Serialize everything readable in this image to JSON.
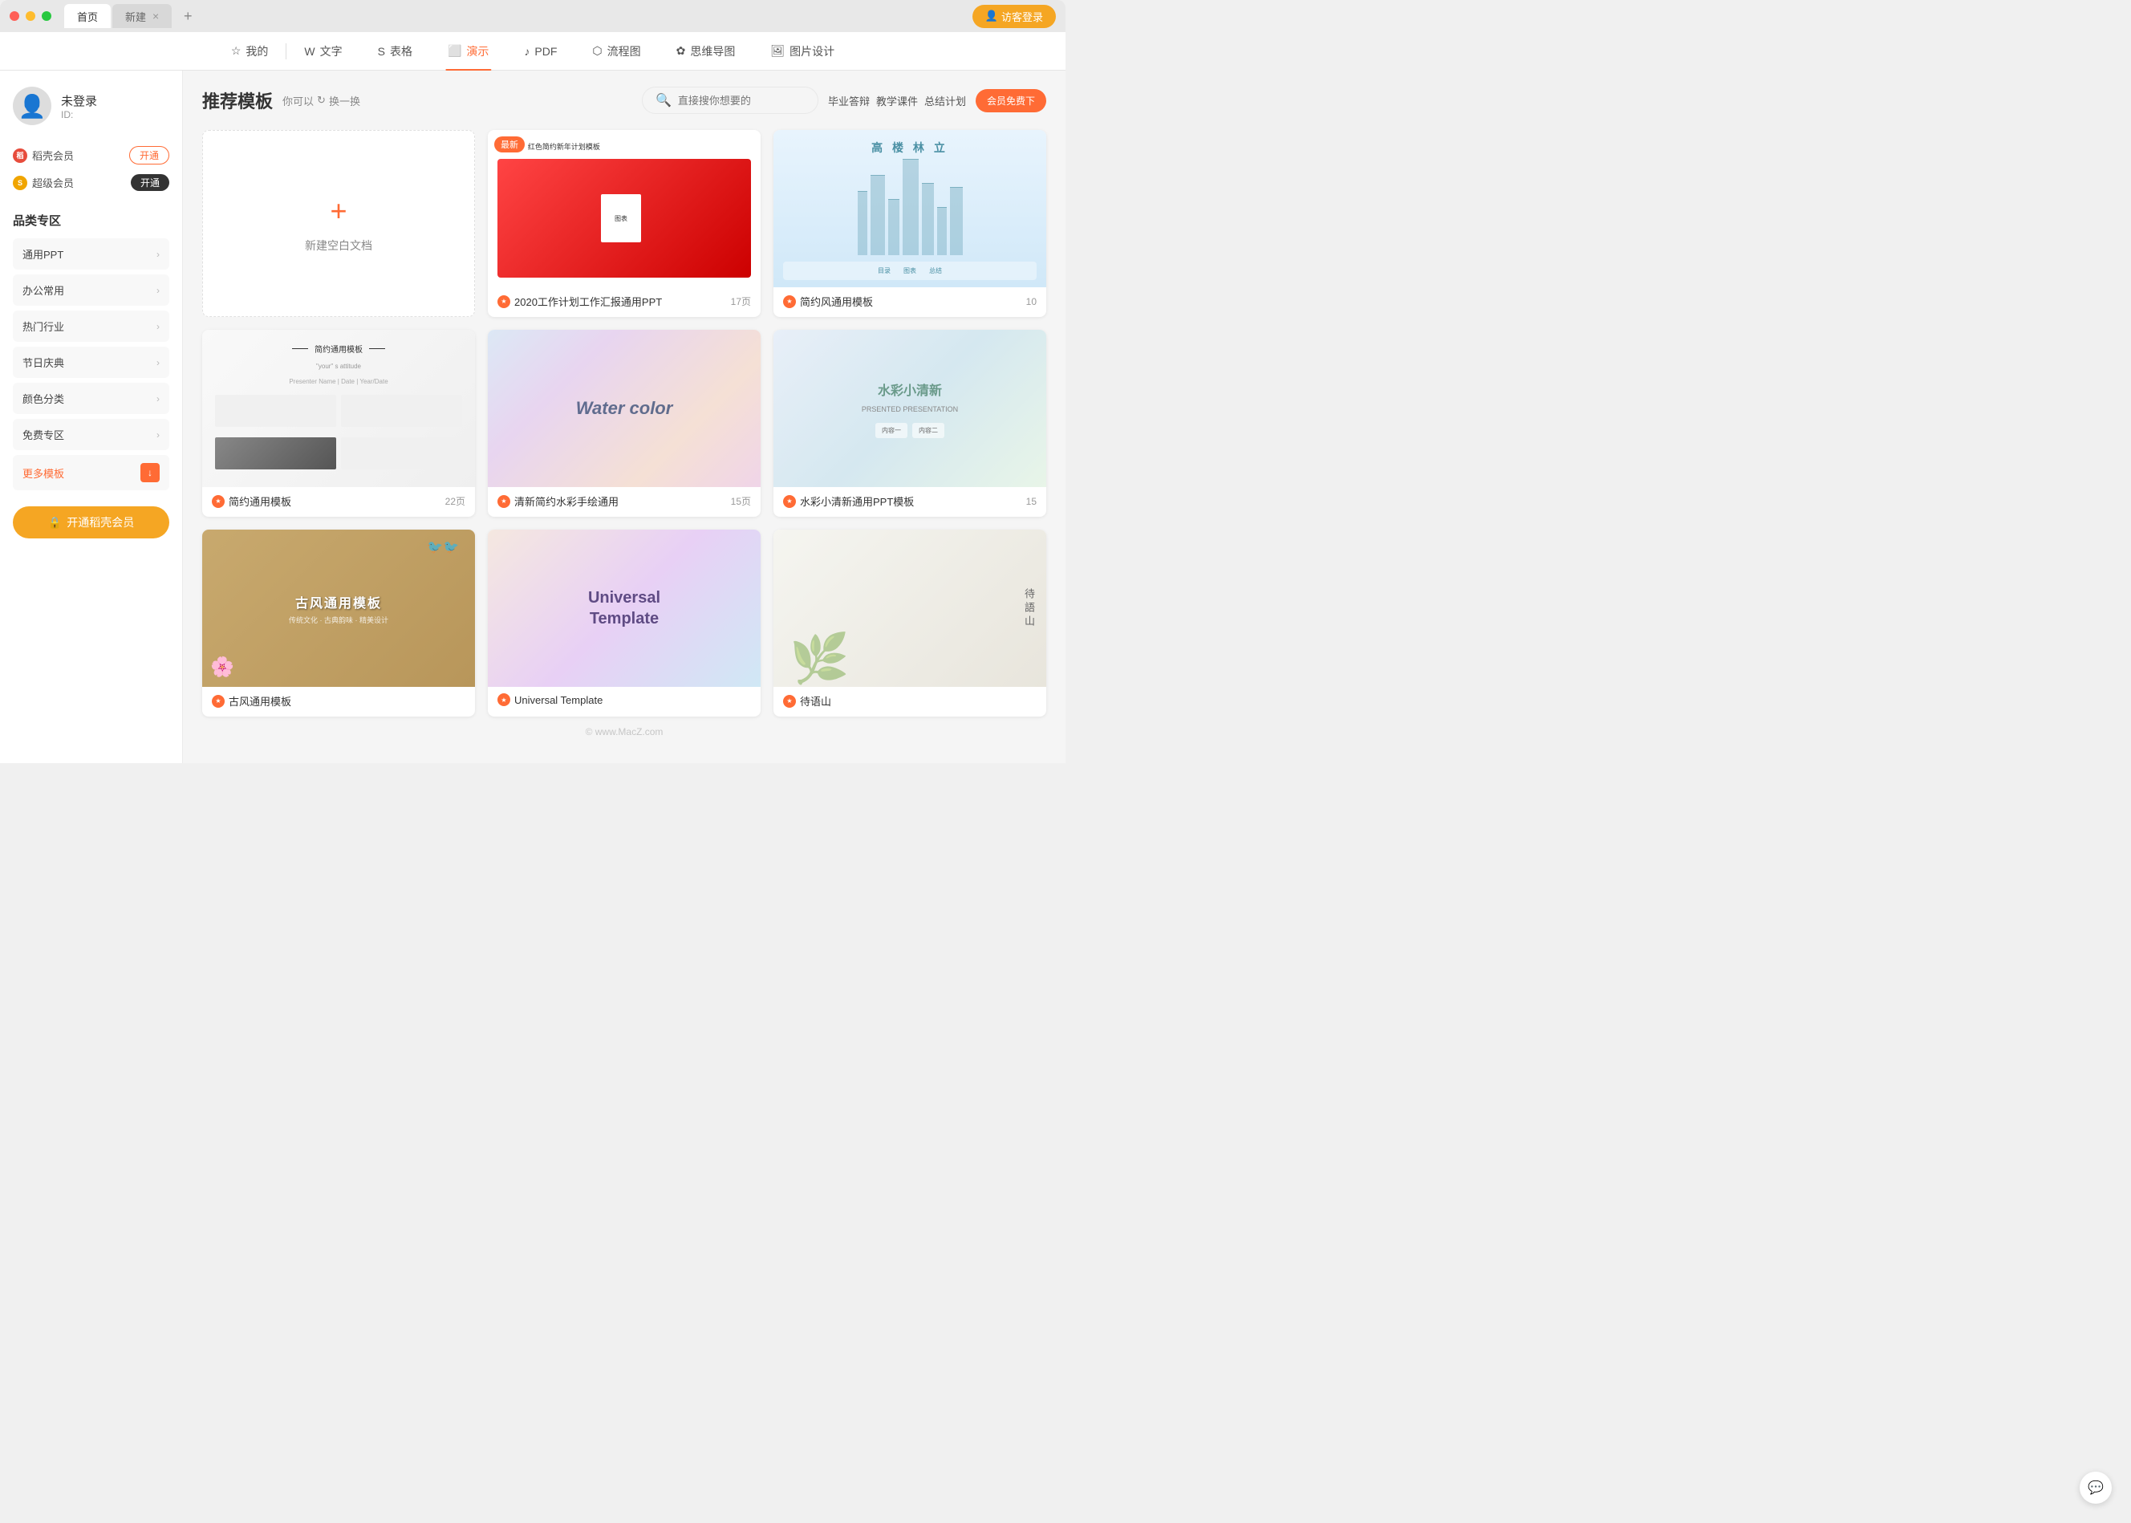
{
  "titlebar": {
    "tabs": [
      {
        "label": "首页",
        "active": true
      },
      {
        "label": "新建",
        "active": false
      }
    ],
    "tab_add_label": "+",
    "guest_login": "访客登录"
  },
  "navbar": {
    "items": [
      {
        "label": "我的",
        "icon": "star",
        "active": false
      },
      {
        "label": "文字",
        "icon": "W",
        "active": false
      },
      {
        "label": "表格",
        "icon": "S",
        "active": false
      },
      {
        "label": "演示",
        "icon": "P",
        "active": true
      },
      {
        "label": "PDF",
        "icon": "pdf",
        "active": false
      },
      {
        "label": "流程图",
        "icon": "flow",
        "active": false
      },
      {
        "label": "思维导图",
        "icon": "mind",
        "active": false
      },
      {
        "label": "图片设计",
        "icon": "img",
        "active": false
      }
    ]
  },
  "sidebar": {
    "username": "未登录",
    "user_id": "ID:",
    "memberships": [
      {
        "label": "稻壳会员",
        "icon_type": "rice",
        "btn_label": "开通",
        "btn_filled": false
      },
      {
        "label": "超级会员",
        "icon_type": "super",
        "btn_label": "开通",
        "btn_filled": true
      }
    ],
    "section_title": "品类专区",
    "categories": [
      {
        "label": "通用PPT"
      },
      {
        "label": "办公常用"
      },
      {
        "label": "热门行业"
      },
      {
        "label": "节日庆典"
      },
      {
        "label": "颜色分类"
      },
      {
        "label": "免费专区"
      },
      {
        "label": "更多模板"
      }
    ],
    "activate_btn": "开通稻壳会员"
  },
  "content": {
    "title": "推荐模板",
    "hint_prefix": "你可以",
    "hint_action": "换一换",
    "search_placeholder": "直接搜你想要的",
    "quick_tags": [
      "毕业答辩",
      "教学课件",
      "总结计划"
    ],
    "vip_label": "会员免费下",
    "new_doc_label": "新建空白文档",
    "templates": [
      {
        "id": "new-blank",
        "type": "new"
      },
      {
        "id": "wps-plan",
        "name": "2020工作计划工作汇报通用PPT",
        "pages": "17页",
        "badge": "最新",
        "thumb_type": "wps"
      },
      {
        "id": "simple-general",
        "name": "简约风通用模板",
        "pages": "10",
        "badge": "",
        "thumb_type": "skyline"
      },
      {
        "id": "simple-common",
        "name": "简约通用模板",
        "pages": "22页",
        "badge": "",
        "thumb_type": "simple"
      },
      {
        "id": "watercolor-hand",
        "name": "清新简约水彩手绘通用",
        "pages": "15页",
        "badge": "",
        "thumb_type": "watercolor"
      },
      {
        "id": "watercolor-fresh",
        "name": "水彩小清新通用PPT模板",
        "pages": "15",
        "badge": "",
        "thumb_type": "watercolor2"
      },
      {
        "id": "ancient-style",
        "name": "古风通用模板",
        "pages": "",
        "badge": "",
        "thumb_type": "ancient"
      },
      {
        "id": "universal-template",
        "name": "Universal Template",
        "pages": "",
        "badge": "",
        "thumb_type": "universal"
      },
      {
        "id": "chinese-style",
        "name": "待语山",
        "pages": "",
        "badge": "",
        "thumb_type": "chinese"
      }
    ]
  },
  "watermark": "© www.MacZ.com"
}
